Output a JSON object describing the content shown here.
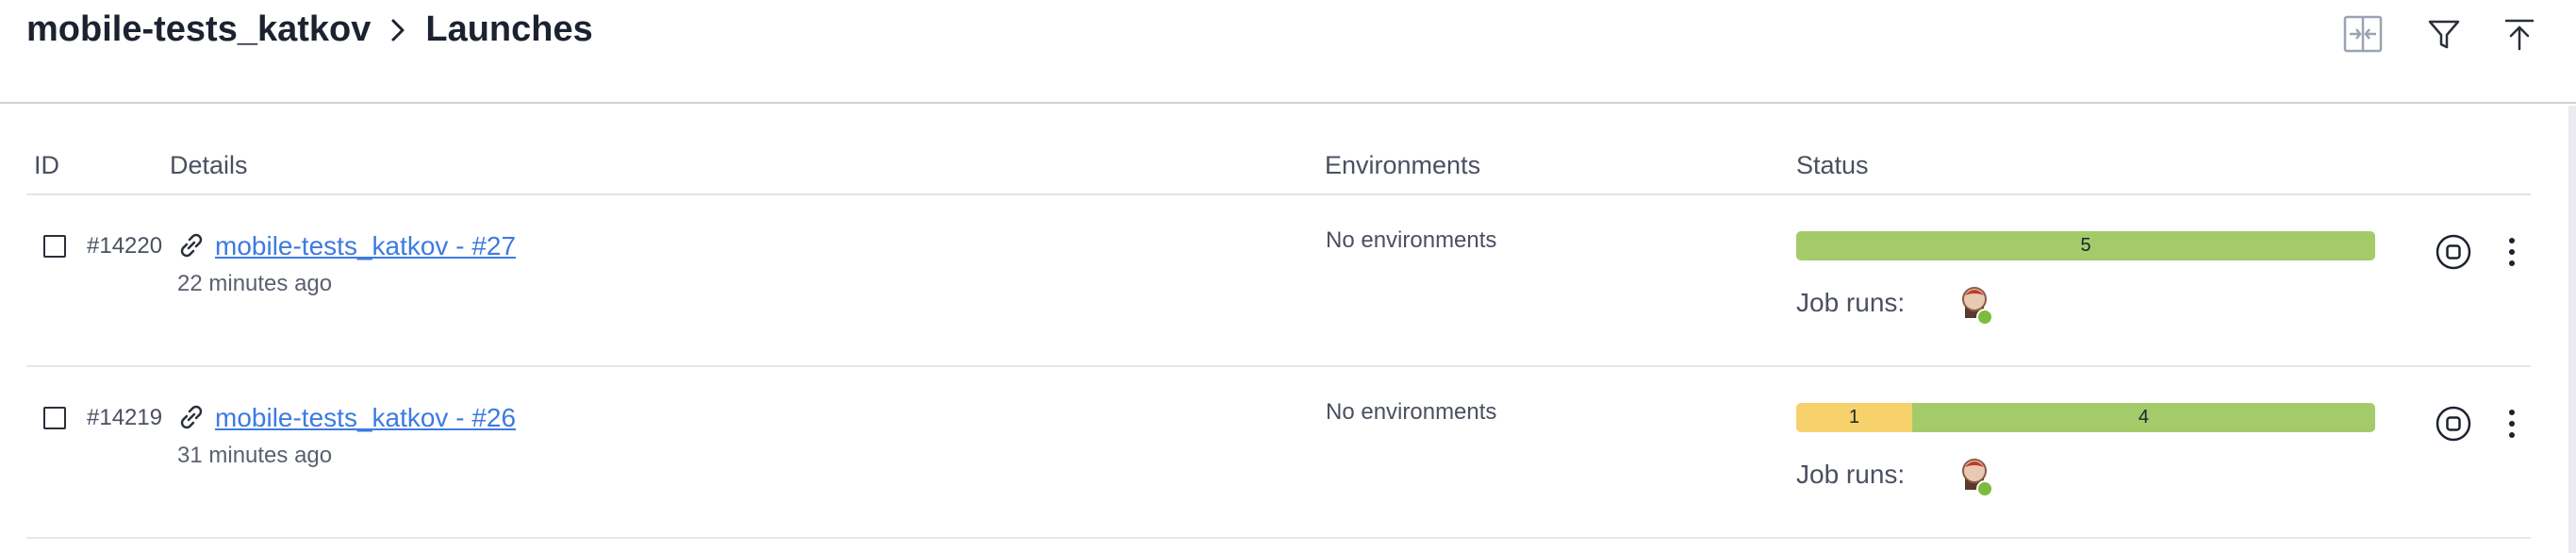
{
  "breadcrumb": {
    "project": "mobile-tests_katkov",
    "page": "Launches"
  },
  "toolbar": {
    "icons": [
      "compare-icon",
      "filter-icon",
      "upload-icon"
    ]
  },
  "table": {
    "columns": {
      "id": "ID",
      "details": "Details",
      "environments": "Environments",
      "status": "Status"
    },
    "rows": [
      {
        "id": "#14220",
        "name": "mobile-tests_katkov - #27",
        "time": "22 minutes ago",
        "environment": "No environments",
        "status_segments": [
          {
            "label": "5",
            "value": 5,
            "color": "#a3cb6a"
          }
        ],
        "job_runs_label": "Job runs:",
        "job_status_color": "#7dbb3e"
      },
      {
        "id": "#14219",
        "name": "mobile-tests_katkov - #26",
        "time": "31 minutes ago",
        "environment": "No environments",
        "status_segments": [
          {
            "label": "1",
            "value": 1,
            "color": "#f7d16b"
          },
          {
            "label": "4",
            "value": 4,
            "color": "#a3cb6a"
          }
        ],
        "job_runs_label": "Job runs:",
        "job_status_color": "#7dbb3e"
      }
    ]
  }
}
